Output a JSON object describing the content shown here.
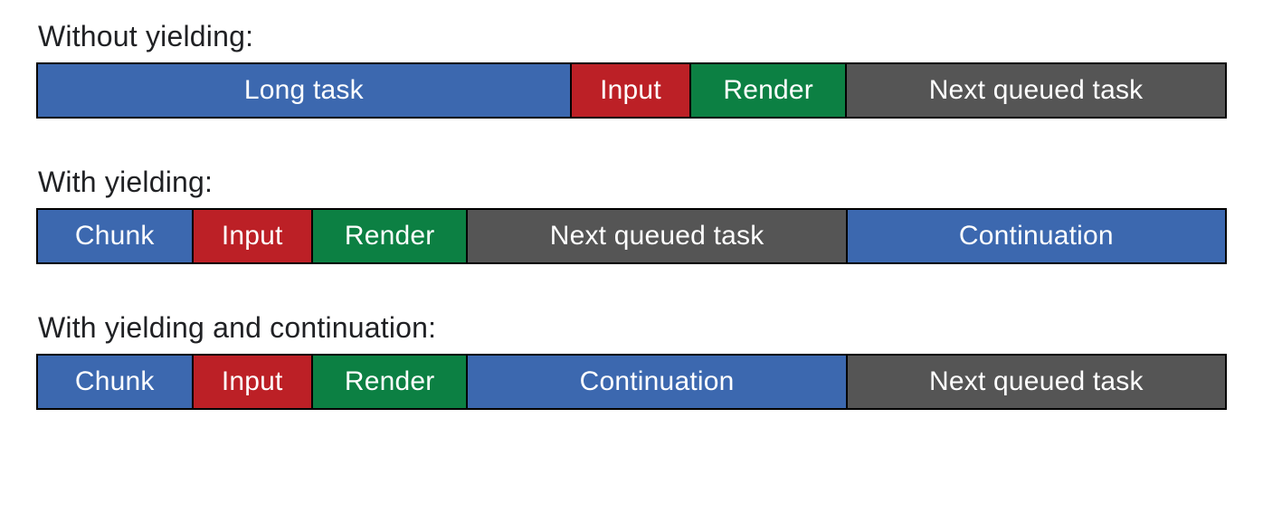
{
  "colors": {
    "blue": "#3c68af",
    "red": "#bc2026",
    "green": "#0c8043",
    "gray": "#555555"
  },
  "rows": [
    {
      "title": "Without yielding:",
      "segments": [
        {
          "label": "Long task",
          "color": "blue",
          "flex": 45
        },
        {
          "label": "Input",
          "color": "red",
          "flex": 10
        },
        {
          "label": "Render",
          "color": "green",
          "flex": 13
        },
        {
          "label": "Next queued task",
          "color": "gray",
          "flex": 32
        }
      ]
    },
    {
      "title": "With yielding:",
      "segments": [
        {
          "label": "Chunk",
          "color": "blue",
          "flex": 13
        },
        {
          "label": "Input",
          "color": "red",
          "flex": 10
        },
        {
          "label": "Render",
          "color": "green",
          "flex": 13
        },
        {
          "label": "Next queued task",
          "color": "gray",
          "flex": 32
        },
        {
          "label": "Continuation",
          "color": "blue",
          "flex": 32
        }
      ]
    },
    {
      "title": "With yielding and continuation:",
      "segments": [
        {
          "label": "Chunk",
          "color": "blue",
          "flex": 13
        },
        {
          "label": "Input",
          "color": "red",
          "flex": 10
        },
        {
          "label": "Render",
          "color": "green",
          "flex": 13
        },
        {
          "label": "Continuation",
          "color": "blue",
          "flex": 32
        },
        {
          "label": "Next queued task",
          "color": "gray",
          "flex": 32
        }
      ]
    }
  ]
}
